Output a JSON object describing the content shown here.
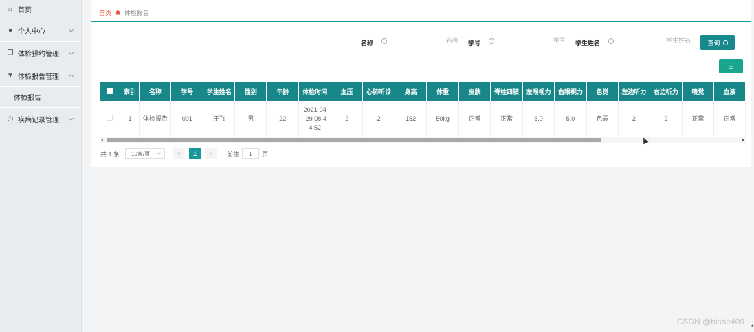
{
  "sidebar": {
    "items": [
      {
        "label": "首页",
        "icon": "home-icon",
        "has_chevron": false
      },
      {
        "label": "个人中心",
        "icon": "user-icon",
        "has_chevron": true,
        "expanded": false
      },
      {
        "label": "体检预约管理",
        "icon": "copy-icon",
        "has_chevron": true,
        "expanded": false
      },
      {
        "label": "体检报告管理",
        "icon": "stamp-icon",
        "has_chevron": true,
        "expanded": true
      },
      {
        "label": "体检报告",
        "is_sub": true
      },
      {
        "label": "疾病记录管理",
        "icon": "clock-icon",
        "has_chevron": true,
        "expanded": false
      }
    ]
  },
  "breadcrumb": {
    "home": "首页",
    "current": "体检报告"
  },
  "search": {
    "name_label": "名称",
    "name_placeholder": "名称",
    "student_no_label": "学号",
    "student_no_placeholder": "学号",
    "student_name_label": "学生姓名",
    "student_name_placeholder": "学生姓名",
    "query_button": "查询"
  },
  "export_button": "±",
  "table": {
    "columns": [
      "索引",
      "名称",
      "学号",
      "学生姓名",
      "性别",
      "年龄",
      "体检时间",
      "血压",
      "心肺听诊",
      "身高",
      "体重",
      "皮肤",
      "脊柱四肢",
      "左眼视力",
      "右眼视力",
      "色觉",
      "左边听力",
      "右边听力",
      "嗅觉",
      "血液"
    ],
    "rows": [
      {
        "cells": [
          "1",
          "体检报告",
          "001",
          "王飞",
          "男",
          "22",
          "2021-04\n-29 08:4\n4:52",
          "2",
          "2",
          "152",
          "50kg",
          "正常",
          "正常",
          "5.0",
          "5.0",
          "色弱",
          "2",
          "2",
          "正常",
          "正常"
        ]
      }
    ]
  },
  "pager": {
    "total": "共 1 条",
    "page_size": "10条/页",
    "prev": "<",
    "current_page": "1",
    "next": ">",
    "goto_label": "前往",
    "goto_value": "1",
    "page_suffix": "页"
  },
  "watermark": "CSDN @bishe409",
  "colors": {
    "primary": "#17878a",
    "accent": "#e6553a",
    "export": "#19a58e"
  }
}
